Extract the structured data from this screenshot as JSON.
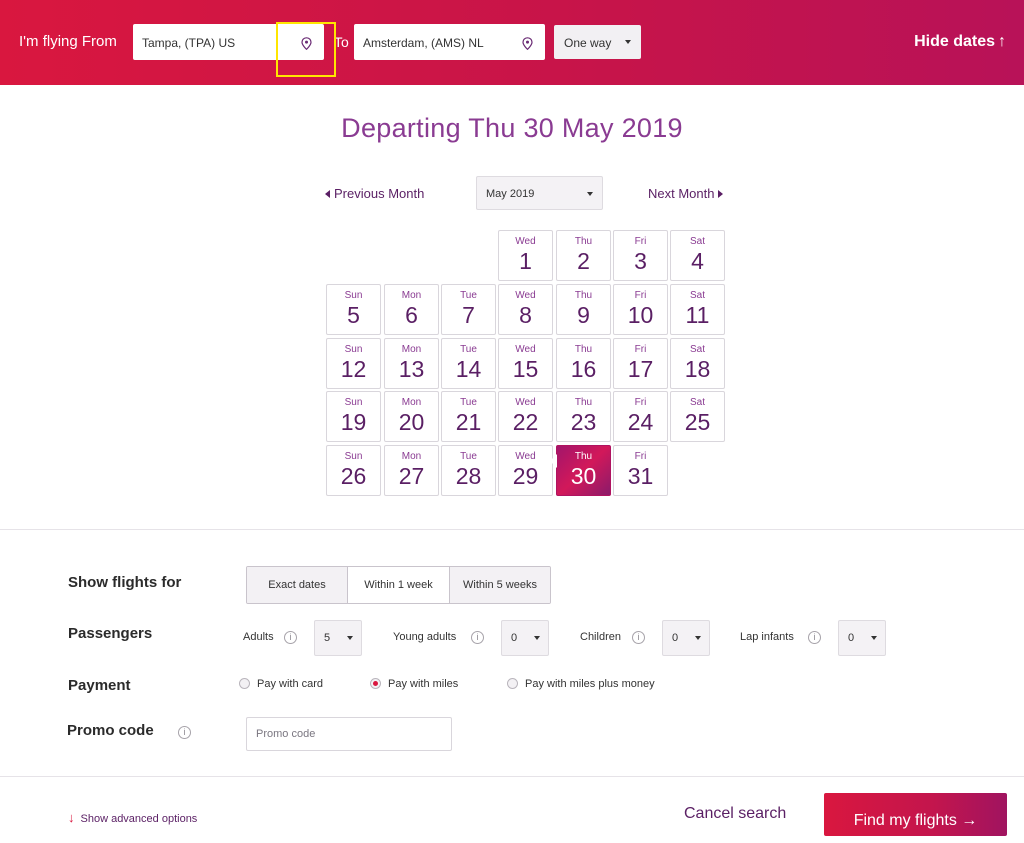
{
  "search_bar": {
    "from_label": "I'm flying From",
    "from_value": "Tampa, (TPA) US",
    "to_label": "To",
    "to_value": "Amsterdam, (AMS) NL",
    "trip_type": "One way",
    "hide_dates": "Hide dates",
    "hide_dates_arrow": "↑"
  },
  "calendar": {
    "title": "Departing Thu 30 May 2019",
    "prev_month": "Previous Month",
    "next_month": "Next Month",
    "month_value": "May 2019",
    "selected_day": 30,
    "days": [
      {
        "dow": "Wed",
        "num": "1"
      },
      {
        "dow": "Thu",
        "num": "2"
      },
      {
        "dow": "Fri",
        "num": "3"
      },
      {
        "dow": "Sat",
        "num": "4"
      },
      {
        "dow": "Sun",
        "num": "5"
      },
      {
        "dow": "Mon",
        "num": "6"
      },
      {
        "dow": "Tue",
        "num": "7"
      },
      {
        "dow": "Wed",
        "num": "8"
      },
      {
        "dow": "Thu",
        "num": "9"
      },
      {
        "dow": "Fri",
        "num": "10"
      },
      {
        "dow": "Sat",
        "num": "11"
      },
      {
        "dow": "Sun",
        "num": "12"
      },
      {
        "dow": "Mon",
        "num": "13"
      },
      {
        "dow": "Tue",
        "num": "14"
      },
      {
        "dow": "Wed",
        "num": "15"
      },
      {
        "dow": "Thu",
        "num": "16"
      },
      {
        "dow": "Fri",
        "num": "17"
      },
      {
        "dow": "Sat",
        "num": "18"
      },
      {
        "dow": "Sun",
        "num": "19"
      },
      {
        "dow": "Mon",
        "num": "20"
      },
      {
        "dow": "Tue",
        "num": "21"
      },
      {
        "dow": "Wed",
        "num": "22"
      },
      {
        "dow": "Thu",
        "num": "23"
      },
      {
        "dow": "Fri",
        "num": "24"
      },
      {
        "dow": "Sat",
        "num": "25"
      },
      {
        "dow": "Sun",
        "num": "26"
      },
      {
        "dow": "Mon",
        "num": "27"
      },
      {
        "dow": "Tue",
        "num": "28"
      },
      {
        "dow": "Wed",
        "num": "29"
      },
      {
        "dow": "Thu",
        "num": "30"
      },
      {
        "dow": "Fri",
        "num": "31"
      }
    ]
  },
  "options": {
    "show_flights_label": "Show flights for",
    "flex_options": [
      "Exact dates",
      "Within 1 week",
      "Within 5 weeks"
    ],
    "flex_selected": "Within 1 week",
    "passengers_label": "Passengers",
    "passengers": [
      {
        "label": "Adults",
        "value": "5"
      },
      {
        "label": "Young adults",
        "value": "0"
      },
      {
        "label": "Children",
        "value": "0"
      },
      {
        "label": "Lap infants",
        "value": "0"
      }
    ],
    "info_glyph": "i",
    "payment_label": "Payment",
    "payment_options": [
      "Pay with card",
      "Pay with miles",
      "Pay with miles plus money"
    ],
    "payment_selected": "Pay with miles",
    "promo_label": "Promo code",
    "promo_placeholder": "Promo code"
  },
  "footer": {
    "advanced_options": "Show advanced options",
    "advanced_arrow": "↓",
    "cancel": "Cancel search",
    "find": "Find my flights →"
  },
  "colors": {
    "brand_red": "#d9173f",
    "brand_purple": "#5a1f64",
    "title_purple": "#8a3b92",
    "highlight_yellow": "#ffe600"
  },
  "icons": {
    "location": "location-pin-icon",
    "caret": "caret-down-icon",
    "info": "info-icon",
    "arrow_up": "arrow-up-icon",
    "arrow_down": "arrow-down-icon"
  }
}
